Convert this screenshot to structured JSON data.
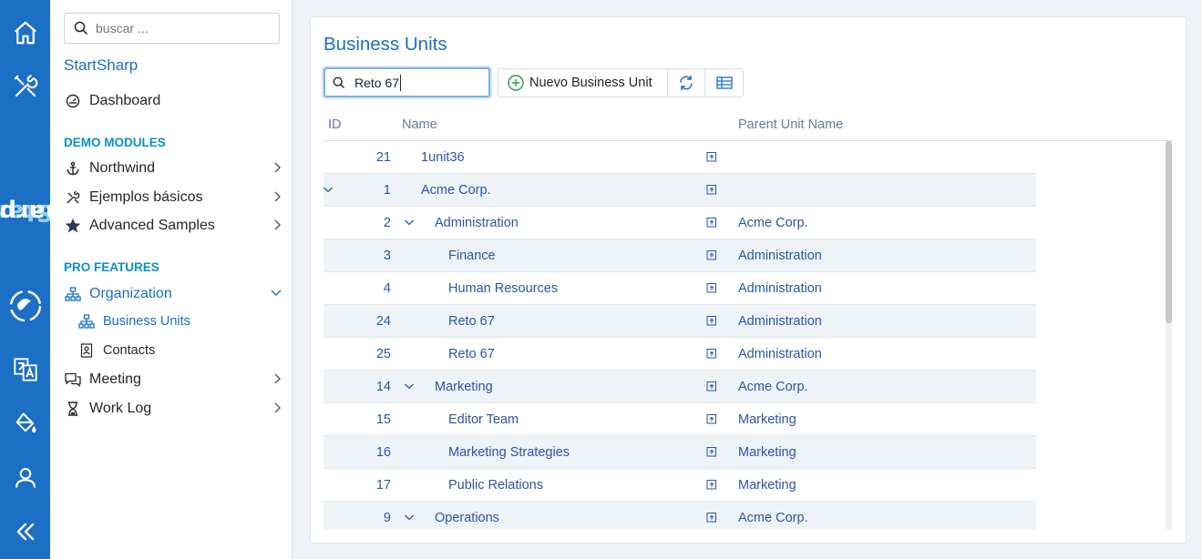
{
  "rail": {
    "brand_start": "Start",
    "brand_sharp": "Sharp",
    "icons": [
      "home-icon",
      "tools-icon",
      "logo-icon",
      "translate-icon",
      "paint-bucket-icon",
      "user-icon",
      "collapse-icon"
    ]
  },
  "sidebar": {
    "search_placeholder": "buscar ...",
    "title": "StartSharp",
    "dashboard": "Dashboard",
    "section_demo": "DEMO MODULES",
    "northwind": "Northwind",
    "ejemplos": "Ejemplos básicos",
    "advanced": "Advanced Samples",
    "section_pro": "PRO FEATURES",
    "organization": "Organization",
    "business_units": "Business Units",
    "contacts": "Contacts",
    "meeting": "Meeting",
    "work_log": "Work Log"
  },
  "main": {
    "title": "Business Units",
    "quick_search_value": "Reto 67",
    "new_button": "Nuevo Business Unit",
    "columns": {
      "id": "ID",
      "name": "Name",
      "parent": "Parent Unit Name"
    },
    "rows": [
      {
        "id": "21",
        "name": "1unit36",
        "parent": "",
        "level": 0,
        "expandable": false
      },
      {
        "id": "1",
        "name": "Acme Corp.",
        "parent": "",
        "level": 0,
        "expandable": true
      },
      {
        "id": "2",
        "name": "Administration",
        "parent": "Acme Corp.",
        "level": 1,
        "expandable": true
      },
      {
        "id": "3",
        "name": "Finance",
        "parent": "Administration",
        "level": 2,
        "expandable": false
      },
      {
        "id": "4",
        "name": "Human Resources",
        "parent": "Administration",
        "level": 2,
        "expandable": false
      },
      {
        "id": "24",
        "name": "Reto 67",
        "parent": "Administration",
        "level": 2,
        "expandable": false
      },
      {
        "id": "25",
        "name": "Reto 67",
        "parent": "Administration",
        "level": 2,
        "expandable": false
      },
      {
        "id": "14",
        "name": "Marketing",
        "parent": "Acme Corp.",
        "level": 1,
        "expandable": true
      },
      {
        "id": "15",
        "name": "Editor Team",
        "parent": "Marketing",
        "level": 2,
        "expandable": false
      },
      {
        "id": "16",
        "name": "Marketing Strategies",
        "parent": "Marketing",
        "level": 2,
        "expandable": false
      },
      {
        "id": "17",
        "name": "Public Relations",
        "parent": "Marketing",
        "level": 2,
        "expandable": false
      },
      {
        "id": "9",
        "name": "Operations",
        "parent": "Acme Corp.",
        "level": 1,
        "expandable": true
      }
    ]
  },
  "colors": {
    "accent": "#1b6fc4",
    "section": "#0c8fc2",
    "link": "#2b56a8",
    "alt_row": "#eef3f7"
  }
}
